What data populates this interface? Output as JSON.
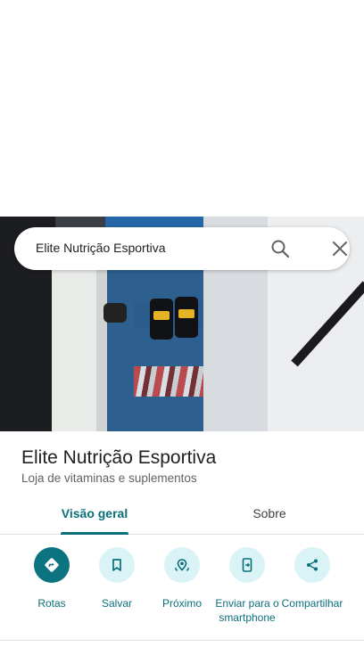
{
  "search": {
    "query": "Elite Nutrição Esportiva"
  },
  "place": {
    "name": "Elite Nutrição Esportiva",
    "category": "Loja de vitaminas e suplementos"
  },
  "tabs": [
    {
      "label": "Visão geral",
      "active": true
    },
    {
      "label": "Sobre",
      "active": false
    }
  ],
  "actions": [
    {
      "label": "Rotas",
      "icon": "directions-icon"
    },
    {
      "label": "Salvar",
      "icon": "bookmark-icon"
    },
    {
      "label": "Próximo",
      "icon": "nearby-icon"
    },
    {
      "label": "Enviar para o smartphone",
      "icon": "send-to-phone-icon"
    },
    {
      "label": "Compartilhar",
      "icon": "share-icon"
    }
  ],
  "colors": {
    "accent": "#0b6f7a",
    "accent_light": "#d9f3f6"
  }
}
